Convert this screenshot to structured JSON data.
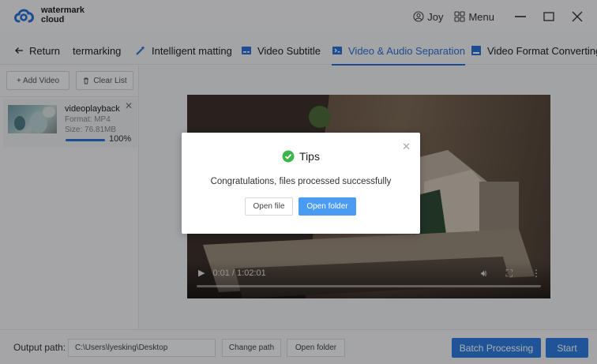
{
  "app": {
    "logo_line1": "watermark",
    "logo_line2": "cloud",
    "user_name": "Joy",
    "menu_label": "Menu"
  },
  "tabs": [
    {
      "label": "Return",
      "icon": "arrow-left-icon"
    },
    {
      "label": "termarking",
      "icon": ""
    },
    {
      "label": "Intelligent matting",
      "icon": "magic-wand-icon"
    },
    {
      "label": "Video Subtitle",
      "icon": "subtitle-icon"
    },
    {
      "label": "Video & Audio Separation",
      "icon": "separation-icon",
      "active": true
    },
    {
      "label": "Video Format Converting",
      "icon": "convert-icon"
    }
  ],
  "left_panel": {
    "add_video": "+ Add Video",
    "clear_list": "Clear List",
    "file": {
      "name": "videoplayback",
      "format": "Format:  MP4",
      "size": "Size:  76.81MB",
      "progress_pct": 100,
      "progress_label": "100%"
    }
  },
  "player": {
    "time": "0:01 / 1:02:01"
  },
  "dialog": {
    "title": "Tips",
    "message": "Congratulations, files processed successfully",
    "open_file": "Open file",
    "open_folder": "Open folder"
  },
  "bottom": {
    "output_label": "Output path:",
    "output_path": "C:\\Users\\lyesking\\Desktop",
    "change_path": "Change path",
    "open_folder": "Open folder",
    "batch": "Batch Processing",
    "start": "Start"
  },
  "colors": {
    "accent": "#2a70d8",
    "primary_button": "#2f7de1",
    "dialog_button": "#4a9cf2",
    "success": "#3bb54a"
  }
}
